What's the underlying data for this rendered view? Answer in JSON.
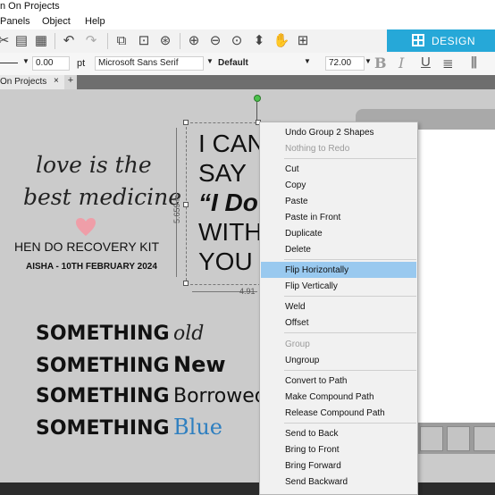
{
  "window": {
    "title": "n On Projects"
  },
  "menubar": {
    "items": [
      "Panels",
      "Object",
      "Help"
    ]
  },
  "toolbar": {
    "design_tab_label": "DESIGN",
    "line_width_value": "0.00",
    "line_width_unit": "pt",
    "font_name": "Microsoft Sans Serif",
    "font_style": "Default",
    "font_size": "72.00",
    "format_buttons": [
      "B",
      "I",
      "U"
    ]
  },
  "tabs": {
    "doc_tab_label": "On Projects",
    "close_label": "×",
    "add_label": "+"
  },
  "artwork": {
    "script_line1": "love is the",
    "script_line2": "best medicine",
    "kit_title": "HEN DO RECOVERY KIT",
    "kit_subtitle": "AISHA - 10TH FEBRUARY 2024",
    "selected_text_lines": [
      "I CAN",
      "SAY",
      "“I Do",
      "WITH",
      "YOU"
    ],
    "height_dimension": "5.659 in",
    "width_dimension": "4.91",
    "something_lines": [
      {
        "word": "SOMETHING",
        "tail": "old"
      },
      {
        "word": "SOMETHING",
        "tail": "New"
      },
      {
        "word": "SOMETHING",
        "tail": "Borrowed"
      },
      {
        "word": "SOMETHING",
        "tail": "Blue"
      }
    ],
    "blue_color": "#2e7fc0",
    "heart_color": "#ef9ea8"
  },
  "context_menu": {
    "items": [
      {
        "label": "Undo Group 2 Shapes",
        "enabled": true
      },
      {
        "label": "Nothing to Redo",
        "enabled": false
      },
      {
        "label": "Cut",
        "enabled": true
      },
      {
        "label": "Copy",
        "enabled": true
      },
      {
        "label": "Paste",
        "enabled": true
      },
      {
        "label": "Paste in Front",
        "enabled": true
      },
      {
        "label": "Duplicate",
        "enabled": true
      },
      {
        "label": "Delete",
        "enabled": true
      },
      {
        "label": "Flip Horizontally",
        "enabled": true,
        "highlighted": true
      },
      {
        "label": "Flip Vertically",
        "enabled": true
      },
      {
        "label": "Weld",
        "enabled": true
      },
      {
        "label": "Offset",
        "enabled": true
      },
      {
        "label": "Group",
        "enabled": false
      },
      {
        "label": "Ungroup",
        "enabled": true
      },
      {
        "label": "Convert to Path",
        "enabled": true
      },
      {
        "label": "Make Compound Path",
        "enabled": true
      },
      {
        "label": "Release Compound Path",
        "enabled": true
      },
      {
        "label": "Send to Back",
        "enabled": true
      },
      {
        "label": "Bring to Front",
        "enabled": true
      },
      {
        "label": "Bring Forward",
        "enabled": true
      },
      {
        "label": "Send Backward",
        "enabled": true
      }
    ]
  },
  "colors": {
    "accent": "#26a8d8",
    "menu_highlight": "#99c9ef"
  },
  "icons": [
    "cut-icon",
    "paste-icon",
    "clipboard-icon",
    "undo-icon",
    "redo-icon",
    "group-icon",
    "ungroup-icon",
    "zoom-in-icon",
    "zoom-out-icon",
    "zoom-fit-icon",
    "move-icon",
    "pan-icon",
    "add-icon",
    "grid-icon",
    "bold-icon",
    "italic-icon",
    "underline-icon",
    "align-icon"
  ]
}
